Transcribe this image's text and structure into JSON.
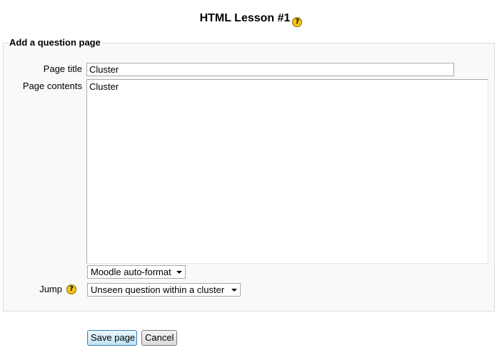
{
  "page": {
    "title": "HTML Lesson #1"
  },
  "icons": {
    "help": "help-icon",
    "help_glyph": "?",
    "dropdown": "chevron-down-icon"
  },
  "form": {
    "legend": "Add a question page",
    "page_title": {
      "label": "Page title",
      "value": "Cluster"
    },
    "page_contents": {
      "label": "Page contents",
      "value": "Cluster"
    },
    "format": {
      "selected": "Moodle auto-format"
    },
    "jump": {
      "label": "Jump",
      "selected": "Unseen question within a cluster"
    }
  },
  "actions": {
    "save_label": "Save page",
    "cancel_label": "Cancel"
  },
  "colors": {
    "help_icon": "#f7c21b",
    "fieldset_bg": "#f9f9f9",
    "primary_button": "#bfe3f6"
  }
}
